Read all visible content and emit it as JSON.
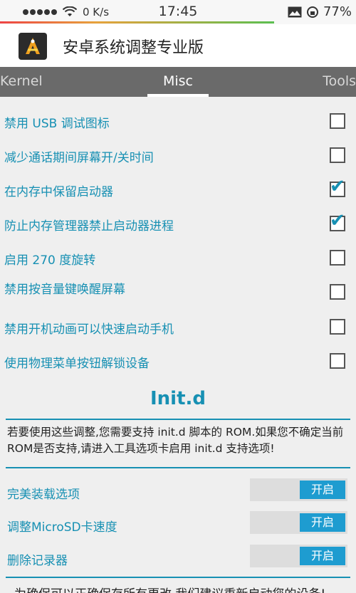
{
  "status_bar": {
    "network_speed": "0 K/s",
    "time": "17:45",
    "battery": "77%"
  },
  "app": {
    "title": "安卓系统调整专业版"
  },
  "tabs": [
    {
      "label": "Kernel"
    },
    {
      "label": "Misc"
    },
    {
      "label": "Tools"
    }
  ],
  "settings": [
    {
      "label": "禁用 USB 调试图标",
      "checked": false
    },
    {
      "label": "减少通话期间屏幕开/关时间",
      "checked": false
    },
    {
      "label": "在内存中保留启动器",
      "checked": true
    },
    {
      "label": "防止内存管理器禁止启动器进程",
      "checked": true
    },
    {
      "label": "启用 270 度旋转",
      "checked": false
    },
    {
      "label": "禁用按音量键唤醒屏幕",
      "checked": false
    },
    {
      "label": "禁用开机动画可以快速启动手机",
      "checked": false
    },
    {
      "label": "使用物理菜单按钮解锁设备",
      "checked": false
    }
  ],
  "initd": {
    "title": "Init.d",
    "description": "若要使用这些调整,您需要支持 init.d 脚本的 ROM.如果您不确定当前ROM是否支持,请进入工具选项卡启用 init.d 支持选项!",
    "switches": [
      {
        "label": "完美装载选项",
        "state": "开启"
      },
      {
        "label": "调整MicroSD卡速度",
        "state": "开启"
      },
      {
        "label": "删除记录器",
        "state": "开启"
      }
    ],
    "footer_cut": "为确保可以正确保存所有更改,我们建议重新启动您的设备!"
  }
}
